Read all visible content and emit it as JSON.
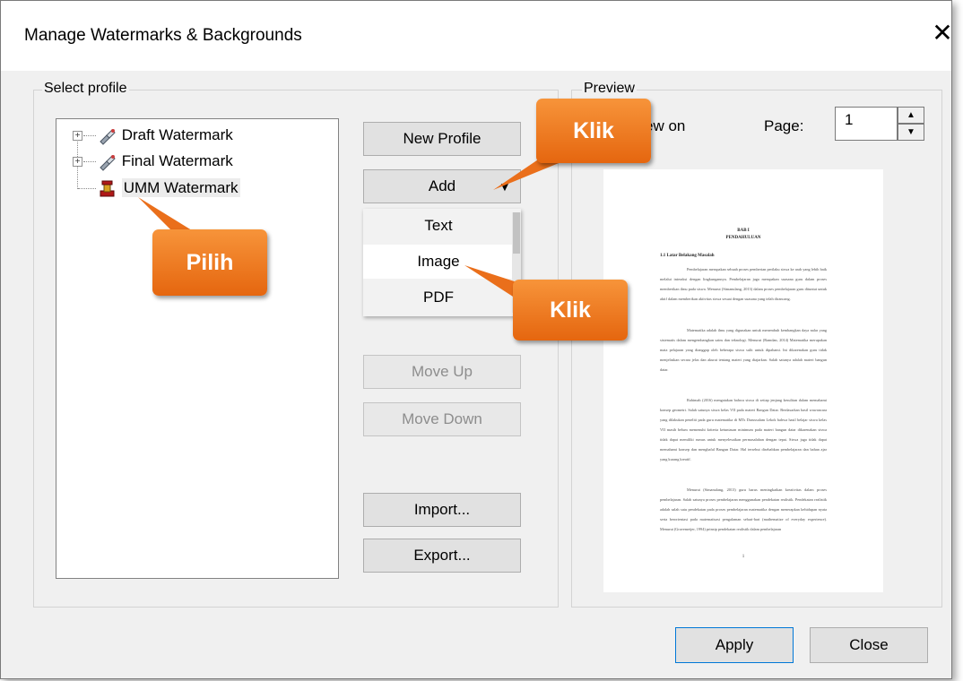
{
  "dialog": {
    "title": "Manage Watermarks & Backgrounds",
    "close_glyph": "✕"
  },
  "select_profile": {
    "label": "Select profile",
    "profiles": [
      {
        "label": "Draft Watermark",
        "icon": "draft-watermark-icon",
        "expandable": true
      },
      {
        "label": "Final Watermark",
        "icon": "final-watermark-icon",
        "expandable": true
      },
      {
        "label": "UMM Watermark",
        "icon": "umm-watermark-icon",
        "expandable": false
      }
    ],
    "expander_glyph": "+",
    "buttons": {
      "new_profile": "New Profile",
      "add": "Add",
      "add_arrow": "▼",
      "move_up": "Move Up",
      "move_down": "Move Down",
      "import": "Import...",
      "export": "Export..."
    },
    "add_menu": [
      "Text",
      "Image",
      "PDF"
    ]
  },
  "preview": {
    "label": "Preview",
    "view_on_label": "ew on",
    "page_label": "Page:",
    "page_value": "1",
    "spin_up": "▲",
    "spin_down": "▼",
    "document": {
      "heading_1": "BAB I",
      "heading_2": "PENDAHULUAN",
      "subheading": "1.1 Latar Belakang Masalah",
      "paragraphs": [
        "Pembelajaran merupakan sebuah proses pemberian perilaku siswa ke arah yang lebih baik melalui interaksi dengan lingkungannya. Pembelajaran juga merupakan suasana guru dalam proses memberikan ilmu pada siswa. Menurut (Simanulang, 2013) dalam proses pembelajaran guru dituntut untuk aktif dalam memberikan aktivitas siswa sesuai dengan suasana yang telah dirancang.",
        "Matematika adalah ilmu yang digunakan untuk menembuh kembangkan daya nalar yang sistematis dalam mengembangkan sains dan teknologi. Menurut (Ramdan, 2014) Matematika merupakan mata pelajaran yang dianggap oleh beberapa siswa sulit untuk dipahami. Ini dikarenakan guru tidak menjelaskan secara jelas dan akurat tentang materi yang diajarkan. Salah satunya adalah materi bangun datar.",
        "Rahimah (2016) mengatakan bahwa siswa di setiap jenjang kesulitan dalam memahami konsep geometri. Salah satunya siswa kelas VII pada materi Bangun Datar. Berdasarkan hasil wawancara yang dilakukan peneliti pada guru matematika di MTs Darussalam Lekok bahwa hasil belajar siswa kelas VII masih belum memenuhi kriteria ketuntasan minimum pada materi bangun datar dikarenakan siswa tidak dapat memiliki rumus untuk menyelesaikan permasalahan dengan tepat. Siswa juga tidak dapat memahami konsep dan menghafal Bangun Datar. Hal tersebut disebabkan pembelajaran dan bahan ajar yang kurang kreatif.",
        "Menurut (Simanulang, 2013) guru harus meningkatkan kreativitas dalam proses pembelajaran. Salah satunya proses pembelajaran menggunakan pendekatan realistik. Pendekatan realistik adalah salah satu pendekatan pada proses pembelajaran matematika dengan menerapkan kehidupan nyata serta berorientasi pada matematisasi pengalaman sehari-hari (mathematize of everyday experience). Menurut (Gravemeijer, 1994) prinsip pendekatan realistik dalam pembelajaran"
      ],
      "page_number": "1"
    }
  },
  "footer": {
    "apply": "Apply",
    "close": "Close"
  },
  "callouts": {
    "klik_add": "Klik",
    "pilih": "Pilih",
    "klik_image": "Klik"
  },
  "colors": {
    "callout": "#ee7a26",
    "dialog_bg": "#f0f0f0",
    "focus_border": "#0078d7"
  }
}
